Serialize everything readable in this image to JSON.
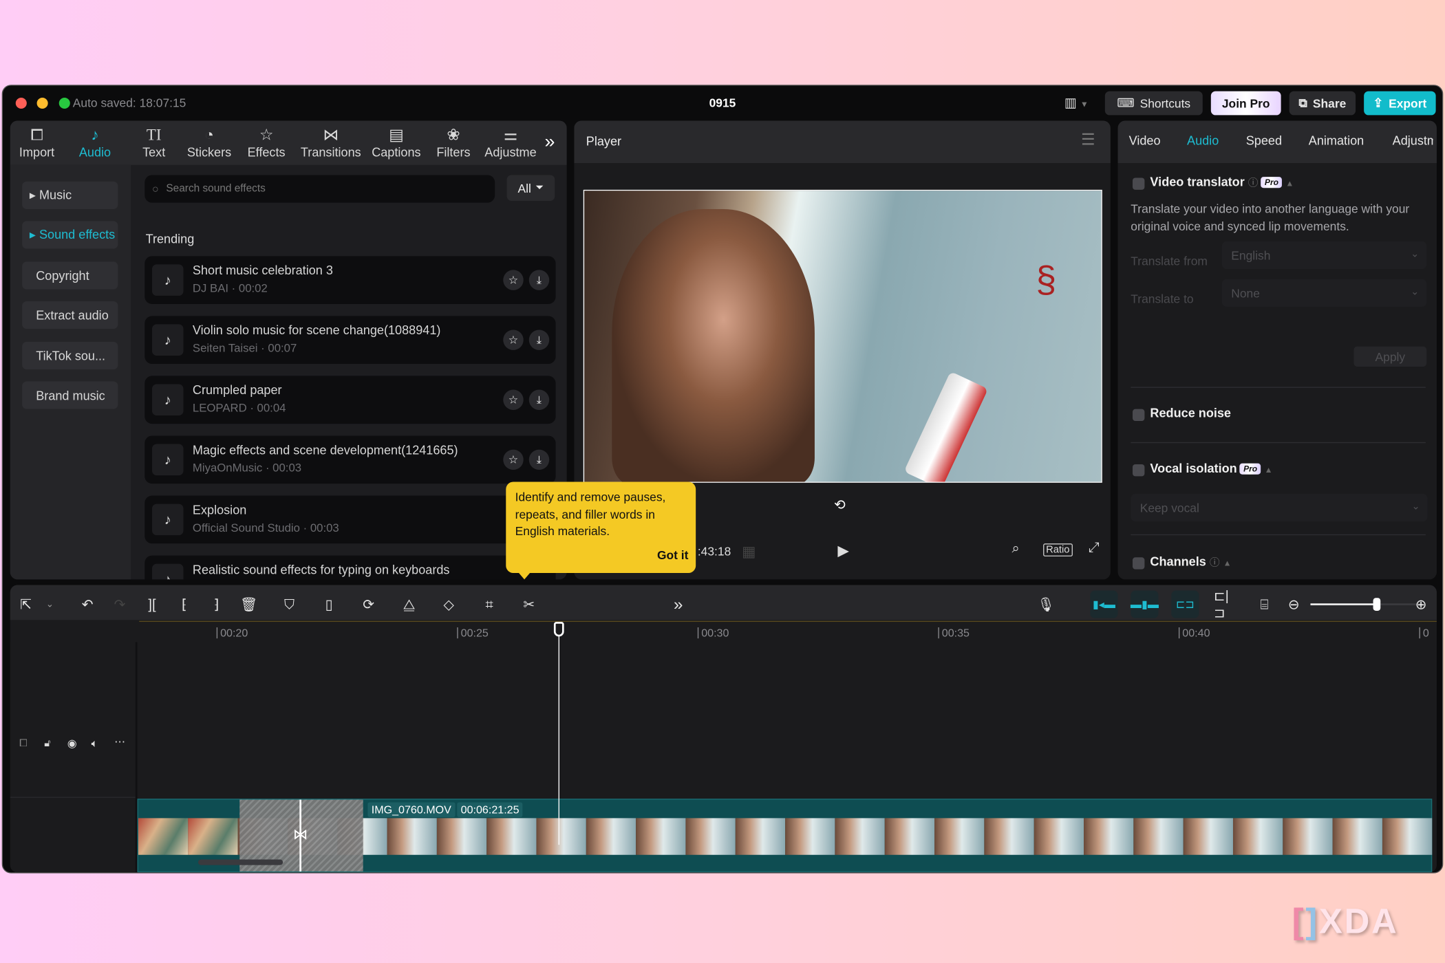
{
  "window": {
    "autosaved": "Auto saved: 18:07:15",
    "title": "0915",
    "layout_icon": "layout-icon",
    "shortcuts_label": "Shortcuts",
    "join_pro_label": "Join Pro",
    "share_label": "Share",
    "export_label": "Export",
    "accent_color": "#1ebcd1"
  },
  "toolbar": {
    "tabs": [
      {
        "label": "Import",
        "icon": "import-icon",
        "glyph": "▶"
      },
      {
        "label": "Audio",
        "icon": "audio-icon",
        "glyph": "♪",
        "active": true
      },
      {
        "label": "Text",
        "icon": "text-icon",
        "glyph": "TI"
      },
      {
        "label": "Stickers",
        "icon": "stickers-icon",
        "glyph": "◔"
      },
      {
        "label": "Effects",
        "icon": "effects-icon",
        "glyph": "☆"
      },
      {
        "label": "Transitions",
        "icon": "transitions-icon",
        "glyph": "⋈"
      },
      {
        "label": "Captions",
        "icon": "captions-icon",
        "glyph": "▤"
      },
      {
        "label": "Filters",
        "icon": "filters-icon",
        "glyph": "⚘"
      },
      {
        "label": "Adjustme",
        "icon": "adjustment-icon",
        "glyph": "⚌"
      }
    ],
    "more": "»"
  },
  "sidebar": {
    "items": [
      {
        "label": "▸ Music"
      },
      {
        "label": "▸ Sound effects",
        "active": true
      },
      {
        "label": "Copyright"
      },
      {
        "label": "Extract audio"
      },
      {
        "label": "TikTok sou..."
      },
      {
        "label": "Brand music"
      }
    ]
  },
  "library": {
    "search_placeholder": "Search sound effects",
    "filter_label": "All",
    "section_title": "Trending",
    "items": [
      {
        "title": "Short music celebration 3",
        "sub": "DJ BAI · 00:02"
      },
      {
        "title": "Violin solo music for scene change(1088941)",
        "sub": "Seiten Taisei · 00:07"
      },
      {
        "title": "Crumpled paper",
        "sub": "LEOPARD · 00:04"
      },
      {
        "title": "Magic effects and scene development(1241665)",
        "sub": "MiyaOnMusic · 00:03"
      },
      {
        "title": "Explosion",
        "sub": "Official Sound Studio · 00:03"
      },
      {
        "title": "Realistic sound effects for typing on keyboards",
        "sub": ""
      }
    ]
  },
  "tooltip": {
    "text": "Identify and remove pauses, repeats, and filler words in English materials.",
    "button": "Got it",
    "color": "#f4c924"
  },
  "player": {
    "title": "Player",
    "time": ":43:18",
    "ratio_label": "Ratio"
  },
  "right_panel": {
    "tabs": [
      {
        "label": "Video"
      },
      {
        "label": "Audio",
        "active": true
      },
      {
        "label": "Speed"
      },
      {
        "label": "Animation"
      },
      {
        "label": "Adjustm"
      }
    ],
    "video_translator": {
      "title": "Video translator",
      "pro": "Pro",
      "description": "Translate your video into another language with your original voice and synced lip movements.",
      "from_label": "Translate from",
      "from_value": "English",
      "to_label": "Translate to",
      "to_value": "None",
      "apply_label": "Apply"
    },
    "reduce_noise": {
      "title": "Reduce noise"
    },
    "vocal_isolation": {
      "title": "Vocal isolation",
      "pro": "Pro",
      "value": "Keep vocal"
    },
    "channels": {
      "title": "Channels"
    }
  },
  "timeline": {
    "ticks": [
      "00:20",
      "00:25",
      "00:30",
      "00:35",
      "00:40",
      "0"
    ],
    "clip_name": "IMG_0760.MOV",
    "clip_duration": "00:06:21:25",
    "zoom_level": 0.6
  },
  "watermark": "XDA"
}
